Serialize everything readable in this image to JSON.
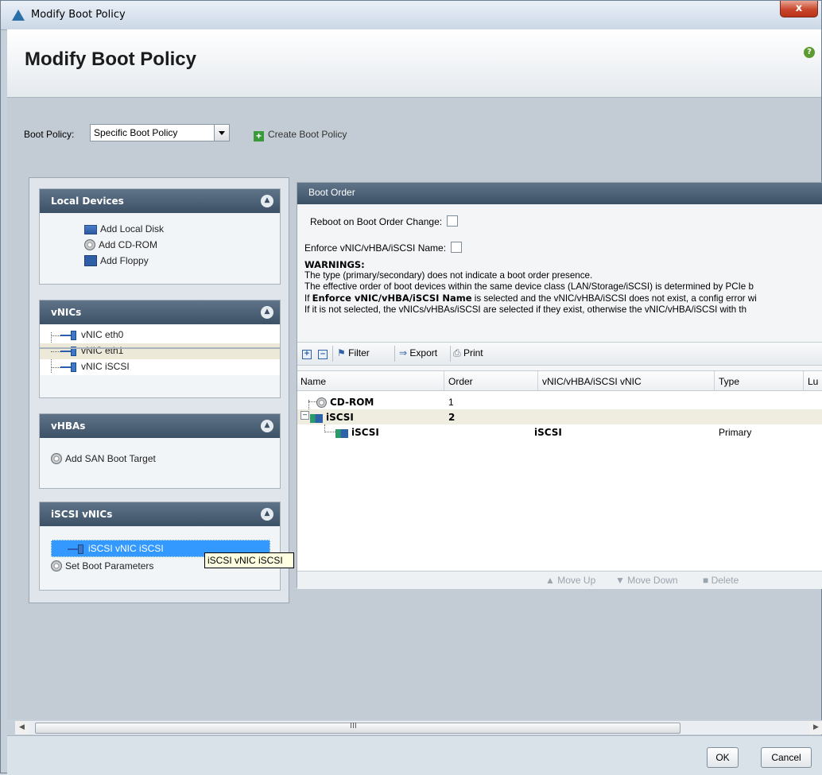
{
  "window": {
    "title": "Modify Boot Policy",
    "close_label": "x"
  },
  "header": {
    "title": "Modify Boot Policy",
    "help_label": "?"
  },
  "boot_policy": {
    "label": "Boot Policy:",
    "selected": "Specific Boot Policy",
    "create_label": "Create Boot Policy",
    "create_icon": "plus-icon"
  },
  "local_devices": {
    "title": "Local Devices",
    "items": [
      {
        "label": "Add Local Disk",
        "icon": "disk-icon"
      },
      {
        "label": "Add CD-ROM",
        "icon": "cdrom-icon"
      },
      {
        "label": "Add Floppy",
        "icon": "floppy-icon"
      }
    ]
  },
  "vnics": {
    "title": "vNICs",
    "items": [
      {
        "label": "vNIC eth0"
      },
      {
        "label": "vNIC eth1"
      },
      {
        "label": "vNIC iSCSI"
      }
    ]
  },
  "vhbas": {
    "title": "vHBAs",
    "items": [
      {
        "label": "Add SAN Boot Target"
      }
    ]
  },
  "iscsi_vnics": {
    "title": "iSCSI vNICs",
    "items": [
      {
        "label": "iSCSI vNIC iSCSI"
      },
      {
        "label": "Set Boot Parameters"
      }
    ],
    "tooltip": "iSCSI vNIC iSCSI"
  },
  "boot_order": {
    "title": "Boot Order",
    "reboot_label": "Reboot on Boot Order Change:",
    "enforce_label": "Enforce vNIC/vHBA/iSCSI Name:",
    "warnings": {
      "heading": "WARNINGS:",
      "line1": "The type (primary/secondary) does not indicate a boot order presence.",
      "line2": "The effective order of boot devices within the same device class (LAN/Storage/iSCSI) is determined by PCIe b",
      "line3_prefix": "If ",
      "line3_bold": "Enforce vNIC/vHBA/iSCSI Name",
      "line3_suffix": " is selected and the vNIC/vHBA/iSCSI does not exist, a config error wi",
      "line4": "If it is not selected, the vNICs/vHBAs/iSCSI are selected if they exist, otherwise the vNIC/vHBA/iSCSI with th"
    },
    "toolbar": {
      "filter": "Filter",
      "export": "Export",
      "print": "Print"
    },
    "columns": [
      "Name",
      "Order",
      "vNIC/vHBA/iSCSI vNIC",
      "Type",
      "Lu"
    ],
    "rows": [
      {
        "name": "CD-ROM",
        "order": "1",
        "vnic": "",
        "type": ""
      },
      {
        "name": "iSCSI",
        "order": "2",
        "vnic": "",
        "type": ""
      },
      {
        "name": "iSCSI",
        "order": "",
        "vnic": "iSCSI",
        "type": "Primary"
      }
    ],
    "footer": {
      "move_up": "Move Up",
      "move_down": "Move Down",
      "delete": "Delete"
    }
  },
  "scrollbar": {
    "thumb_grip": "III"
  },
  "buttons": {
    "ok": "OK",
    "cancel": "Cancel"
  }
}
